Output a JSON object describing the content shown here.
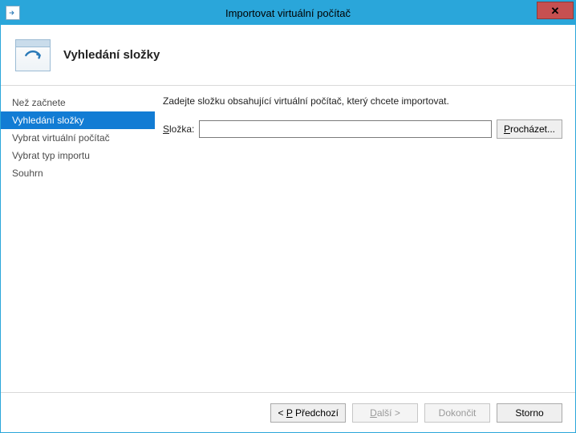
{
  "window": {
    "title": "Importovat virtuální počítač"
  },
  "header": {
    "heading": "Vyhledání složky"
  },
  "sidebar": {
    "items": [
      {
        "label": "Než začnete",
        "active": false
      },
      {
        "label": "Vyhledání složky",
        "active": true
      },
      {
        "label": "Vybrat virtuální počítač",
        "active": false
      },
      {
        "label": "Vybrat typ importu",
        "active": false
      },
      {
        "label": "Souhrn",
        "active": false
      }
    ]
  },
  "content": {
    "instruction": "Zadejte složku obsahující virtuální počítač, který chcete importovat.",
    "folder_label": "Složka:",
    "folder_value": "",
    "browse_label": "Procházet..."
  },
  "footer": {
    "prev_label": "< Předchozí",
    "next_label": "Další >",
    "finish_label": "Dokončit",
    "cancel_label": "Storno"
  }
}
